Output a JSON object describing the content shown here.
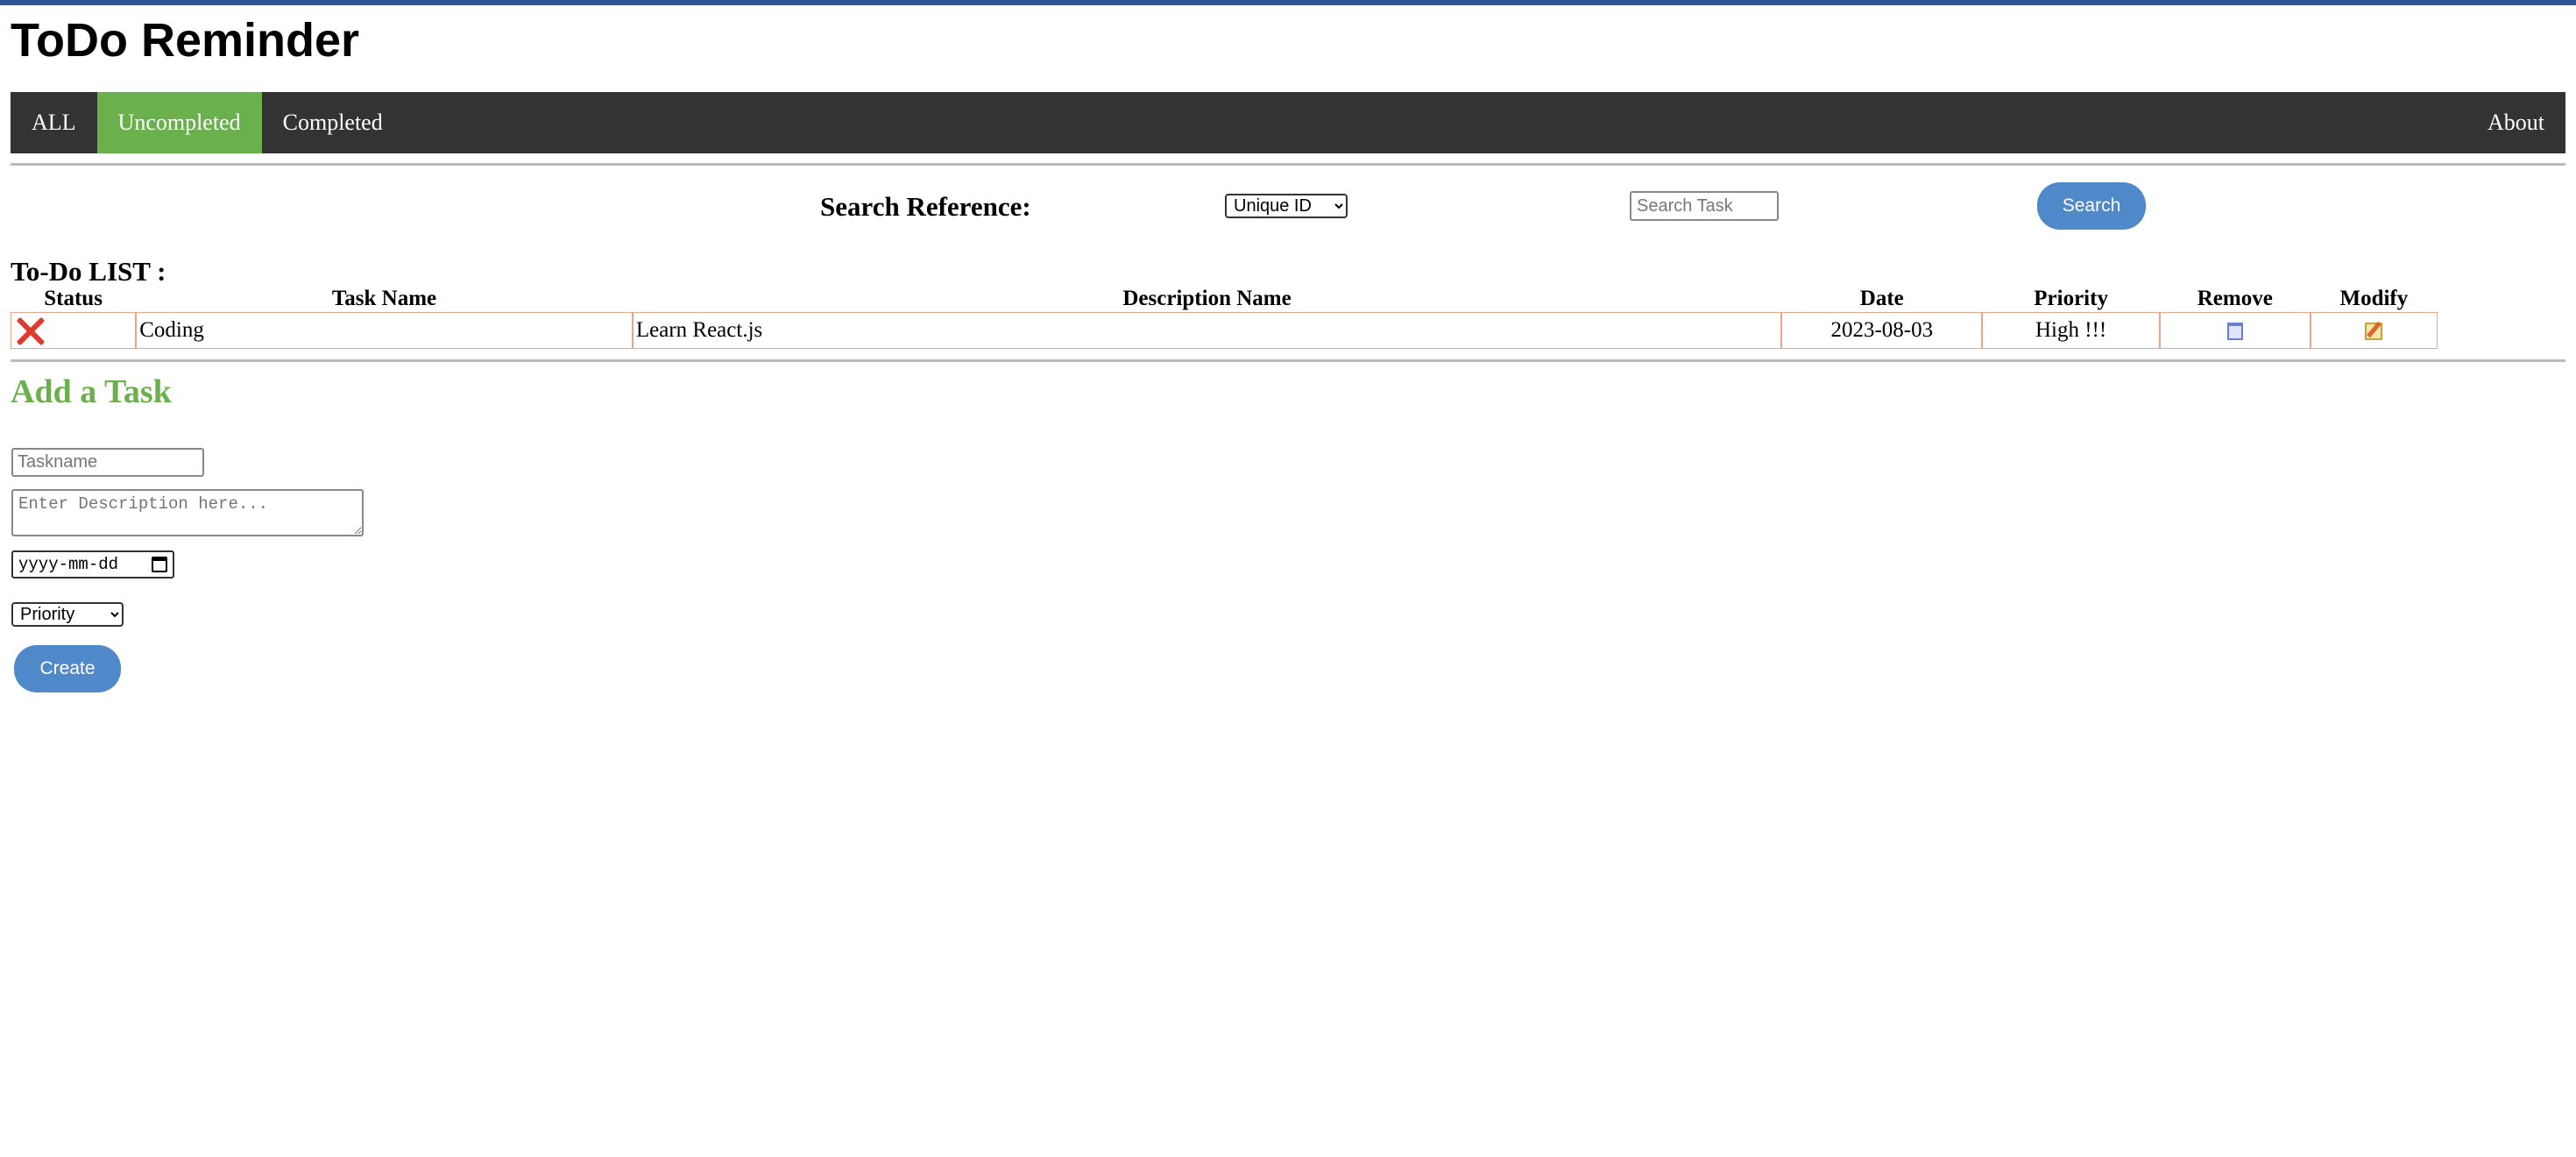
{
  "header": {
    "title": "ToDo Reminder"
  },
  "nav": {
    "items": [
      {
        "label": "ALL",
        "active": false
      },
      {
        "label": "Uncompleted",
        "active": true
      },
      {
        "label": "Completed",
        "active": false
      }
    ],
    "about_label": "About"
  },
  "search": {
    "label": "Search Reference:",
    "reference_selected": "Unique ID",
    "placeholder": "Search Task",
    "button_label": "Search"
  },
  "list": {
    "title": "To-Do LIST :",
    "columns": [
      "Status",
      "Task Name",
      "Description Name",
      "Date",
      "Priority",
      "Remove",
      "Modify"
    ],
    "rows": [
      {
        "status_icon": "red-x-icon",
        "task_name": "Coding",
        "description": "Learn React.js",
        "date": "2023-08-03",
        "priority": "High !!!",
        "remove_icon": "trash-icon",
        "modify_icon": "edit-icon"
      }
    ]
  },
  "add_task": {
    "title": "Add a Task",
    "taskname_placeholder": "Taskname",
    "description_placeholder": "Enter Description here...",
    "date_placeholder": "yyyy-mm-dd",
    "priority_selected": "Priority",
    "create_label": "Create"
  },
  "colors": {
    "top_bar": "#2f5597",
    "nav_bg": "#333333",
    "active_green": "#6ab04c",
    "button_blue": "#4f89c9",
    "table_border": "#e8a58a"
  }
}
